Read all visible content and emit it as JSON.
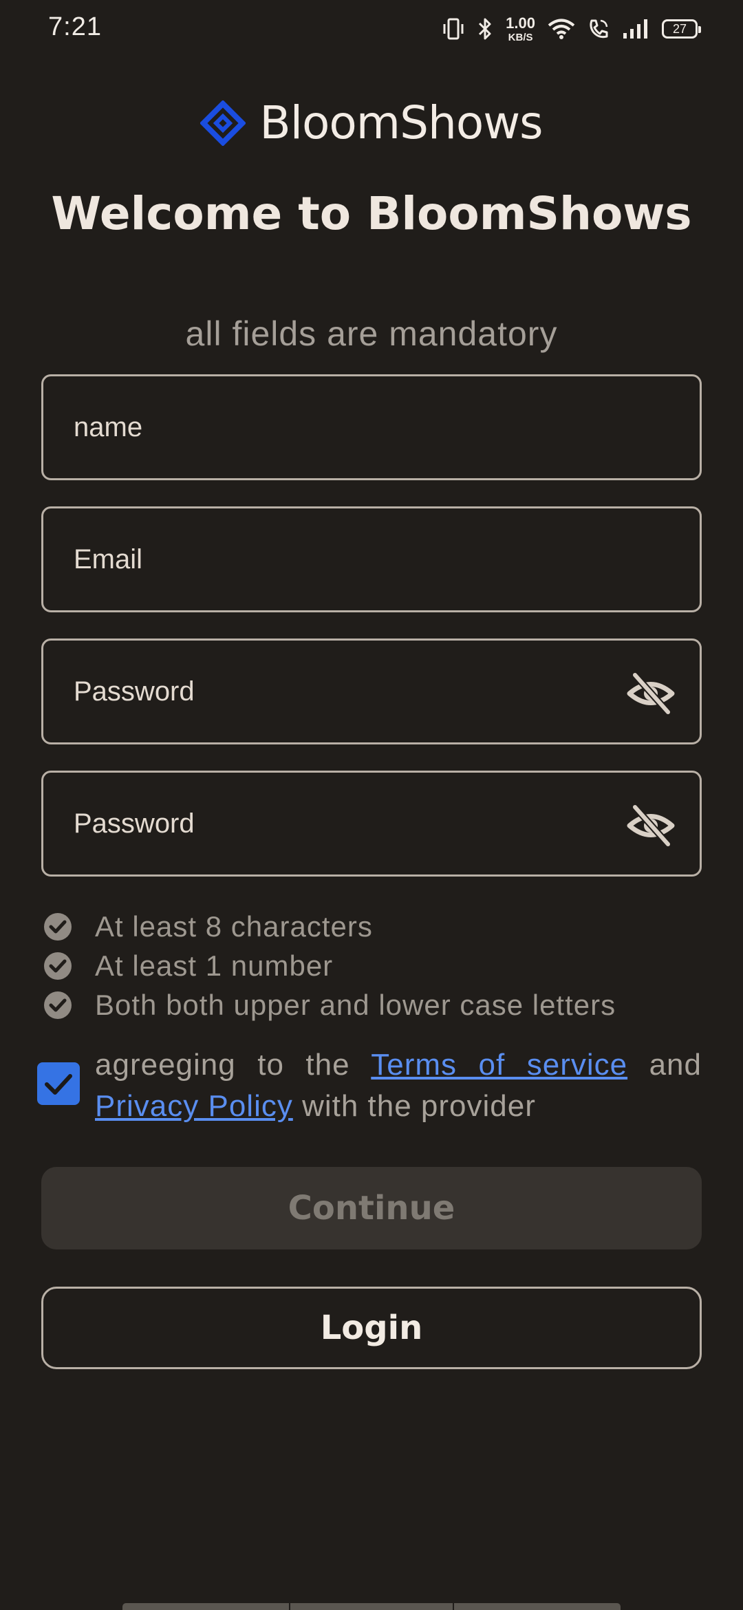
{
  "status_bar": {
    "time": "7:21",
    "net_speed_value": "1.00",
    "net_speed_unit": "KB/S",
    "battery": "27"
  },
  "brand": {
    "name": "BloomShows",
    "logo_color": "#1a4de0"
  },
  "header": {
    "title": "Welcome to BloomShows",
    "subtitle": "all fields are mandatory"
  },
  "form": {
    "name_placeholder": "name",
    "email_placeholder": "Email",
    "password_placeholder": "Password",
    "confirm_password_placeholder": "Password"
  },
  "requirements": [
    {
      "text": "At least 8 characters",
      "met": true
    },
    {
      "text": "At least 1 number",
      "met": true
    },
    {
      "text": "Both both upper and lower case letters",
      "met": true
    }
  ],
  "terms": {
    "checked": true,
    "prefix": "agreeging to the ",
    "terms_link": "Terms of service",
    "middle": " and ",
    "privacy_link": "Privacy Policy",
    "suffix": " with the provider",
    "checkbox_color": "#3573e4",
    "link_color": "#5a8ef0"
  },
  "buttons": {
    "continue_label": "Continue",
    "login_label": "Login"
  },
  "icons": {
    "password_toggle": "eye-off-icon",
    "requirement": "check-circle-icon",
    "checkbox": "checkmark-icon"
  }
}
